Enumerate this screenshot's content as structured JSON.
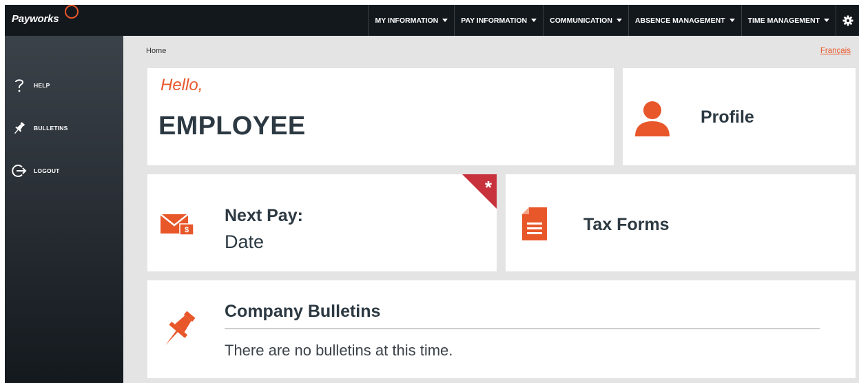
{
  "app": {
    "logo_text": "Payworks"
  },
  "nav": {
    "items": [
      {
        "label": "MY INFORMATION"
      },
      {
        "label": "PAY INFORMATION"
      },
      {
        "label": "COMMUNICATION"
      },
      {
        "label": "ABSENCE MANAGEMENT"
      },
      {
        "label": "TIME MANAGEMENT"
      }
    ],
    "settings_icon": "gear-icon"
  },
  "sidebar": {
    "items": [
      {
        "label": "HELP",
        "icon": "question-icon"
      },
      {
        "label": "BULLETINS",
        "icon": "pin-icon"
      },
      {
        "label": "LOGOUT",
        "icon": "logout-icon"
      }
    ]
  },
  "breadcrumb": {
    "current": "Home"
  },
  "language_link": "Français",
  "greeting": {
    "hello": "Hello,",
    "name": "EMPLOYEE"
  },
  "cards": {
    "profile": {
      "title": "Profile",
      "icon": "person-icon"
    },
    "next_pay": {
      "title": "Next Pay:",
      "value": "Date",
      "icon": "pay-envelope-icon",
      "badge": "*"
    },
    "tax_forms": {
      "title": "Tax Forms",
      "icon": "document-icon"
    },
    "bulletins": {
      "title": "Company Bulletins",
      "message": "There are no bulletins at this time.",
      "icon": "pushpin-icon"
    }
  },
  "colors": {
    "accent": "#e8572a",
    "badge": "#c8323c",
    "dark_text": "#2c3942",
    "topbar": "#13181d"
  }
}
